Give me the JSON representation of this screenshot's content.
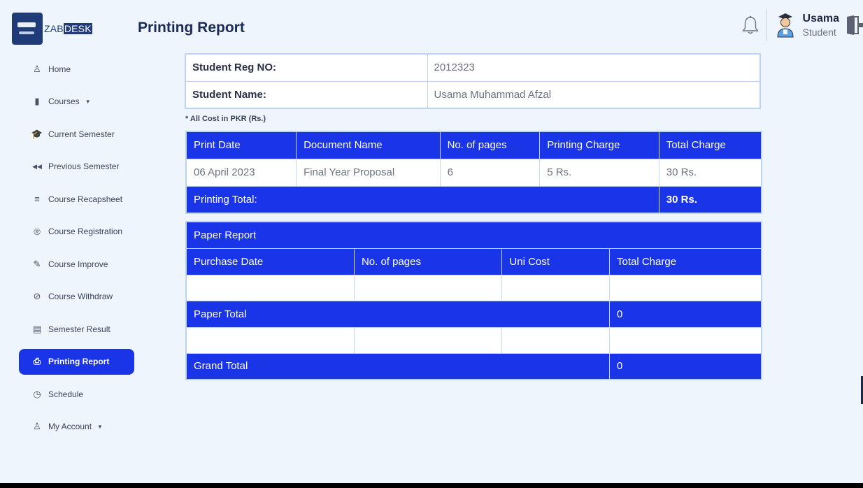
{
  "brand": {
    "text_a": "ZAB",
    "text_b": "DESK"
  },
  "page": {
    "title": "Printing Report"
  },
  "user": {
    "name": "Usama",
    "role": "Student"
  },
  "icons": {
    "bell": "bell-icon",
    "avatar": "student-avatar-icon",
    "logout": "logout-door-icon"
  },
  "sidebar": {
    "items": [
      {
        "label": "Home",
        "icon": "user-outline-icon",
        "glyph": "♙"
      },
      {
        "label": "Courses",
        "icon": "courses-icon",
        "glyph": "▮",
        "caret": "▼"
      },
      {
        "label": "Current Semester",
        "icon": "graduation-cap-icon",
        "glyph": "🎓"
      },
      {
        "label": "Previous Semester",
        "icon": "backward-icon",
        "glyph": "◀◀"
      },
      {
        "label": "Course Recapsheet",
        "icon": "database-icon",
        "glyph": "≡"
      },
      {
        "label": "Course Registration",
        "icon": "registered-icon",
        "glyph": "®"
      },
      {
        "label": "Course Improve",
        "icon": "pencil-icon",
        "glyph": "✎"
      },
      {
        "label": "Course Withdraw",
        "icon": "ban-icon",
        "glyph": "⊘"
      },
      {
        "label": "Semester Result",
        "icon": "result-sheet-icon",
        "glyph": "▤"
      },
      {
        "label": "Printing Report",
        "icon": "printer-icon",
        "glyph": "⎙",
        "active": true
      },
      {
        "label": "Schedule",
        "icon": "clock-icon",
        "glyph": "◷"
      },
      {
        "label": "My Account",
        "icon": "user-outline-icon",
        "glyph": "♙",
        "caret": "▼"
      }
    ]
  },
  "student": {
    "reg_label": "Student Reg NO:",
    "reg_value": "2012323",
    "name_label": "Student Name:",
    "name_value": "Usama Muhammad Afzal"
  },
  "note": "* All Cost in PKR (Rs.)",
  "printing": {
    "headers": [
      "Print Date",
      "Document Name",
      "No. of pages",
      "Printing Charge",
      "Total Charge"
    ],
    "rows": [
      [
        "06 April 2023",
        "Final Year Proposal",
        "6",
        "5 Rs.",
        "30 Rs."
      ]
    ],
    "total_label": "Printing Total:",
    "total_value": "30 Rs."
  },
  "paper": {
    "title": "Paper Report",
    "headers": [
      "Purchase Date",
      "No. of pages",
      "Uni Cost",
      "Total Charge"
    ],
    "total_label": "Paper Total",
    "total_value": "0",
    "grand_label": "Grand Total",
    "grand_value": "0"
  },
  "colors": {
    "accent": "#1a35e8",
    "background": "#eef5fd"
  }
}
